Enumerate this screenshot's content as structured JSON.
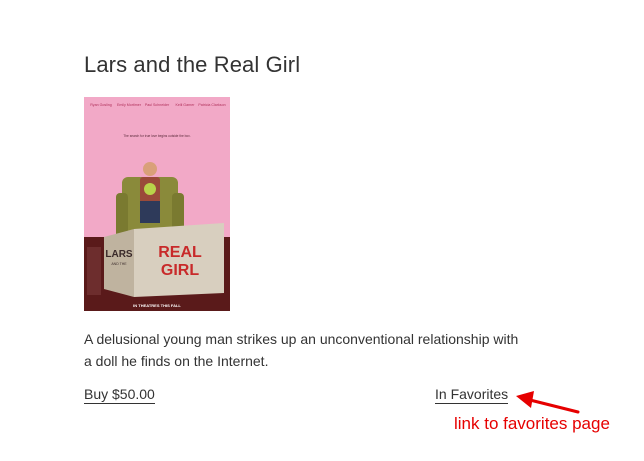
{
  "movie": {
    "title": "Lars and the Real Girl",
    "description": "A delusional young man strikes up an unconventional relationship with a doll he finds on the Internet.",
    "buy_label": "Buy $50.00",
    "favorites_label": "In Favorites"
  },
  "poster": {
    "cast": [
      "Ryan Gosling",
      "Emily Mortimer",
      "Paul Schneider",
      "Kelli Garner",
      "Patricia Clarkson"
    ],
    "tagline": "The search for true love begins outside the box.",
    "title_line1": "LARS",
    "title_line2": "AND THE",
    "title_line3": "REAL",
    "title_line4": "GIRL",
    "release": "IN THEATRES THIS FALL"
  },
  "annotation": {
    "text": "link to favorites page",
    "color": "#e60000"
  },
  "colors": {
    "poster_pink": "#f2a9c7",
    "poster_floor": "#5a1a1a",
    "text": "#333333"
  }
}
